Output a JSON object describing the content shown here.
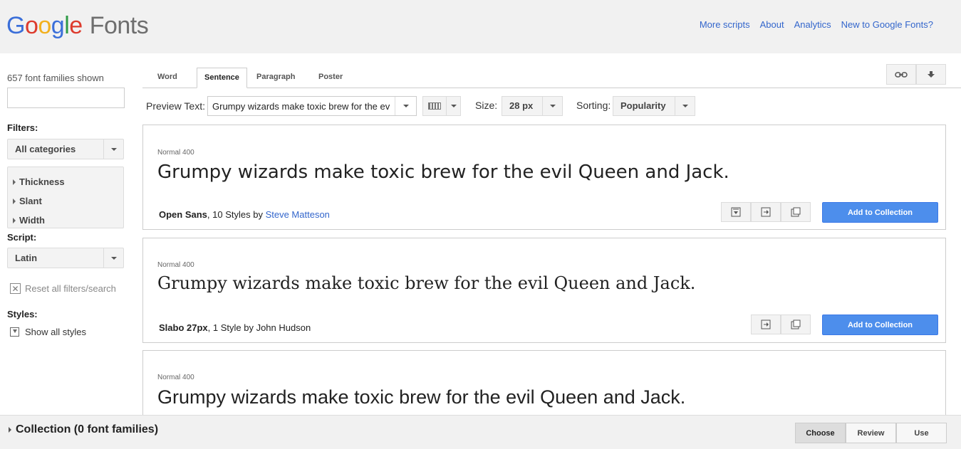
{
  "header": {
    "logo_google": [
      "G",
      "o",
      "o",
      "g",
      "l",
      "e"
    ],
    "logo_fonts": "Fonts",
    "links": [
      "More scripts",
      "About",
      "Analytics",
      "New to Google Fonts?"
    ]
  },
  "sidebar": {
    "count": "657 font families shown",
    "search_value": "",
    "filters_label": "Filters:",
    "category": "All categories",
    "filter_items": [
      "Thickness",
      "Slant",
      "Width"
    ],
    "script_label": "Script:",
    "script": "Latin",
    "reset": "Reset all filters/search",
    "styles_label": "Styles:",
    "show_all": "Show all styles"
  },
  "tabs": [
    "Word",
    "Sentence",
    "Paragraph",
    "Poster"
  ],
  "active_tab": "Sentence",
  "tab_icons": [
    "link-icon",
    "download-icon"
  ],
  "preview": {
    "label": "Preview Text:",
    "value": "Grumpy wizards make toxic brew for the evil Queen and Jack.",
    "size_label": "Size:",
    "size": "28 px",
    "sort_label": "Sorting:",
    "sort": "Popularity"
  },
  "fonts": [
    {
      "style": "Normal 400",
      "sample": "Grumpy wizards make toxic brew for the evil Queen and Jack.",
      "name": "Open Sans",
      "styles_text": ", 10 Styles by ",
      "author": "Steve Matteson",
      "add": "Add to Collection"
    },
    {
      "style": "Normal 400",
      "sample": "Grumpy wizards make toxic brew for the evil Queen and Jack.",
      "name": "Slabo 27px",
      "styles_text": ", 1 Style by ",
      "author": "John Hudson",
      "add": "Add to Collection"
    },
    {
      "style": "Normal 400",
      "sample": "Grumpy wizards make toxic brew for the evil Queen and Jack."
    }
  ],
  "bottom": {
    "collection": "Collection (0 font families)",
    "steps": [
      "Choose",
      "Review",
      "Use"
    ],
    "active_step": "Choose"
  },
  "colors": {
    "accent": "#4d8eec",
    "link": "#3366cc",
    "header_bg": "#f1f1f1"
  }
}
